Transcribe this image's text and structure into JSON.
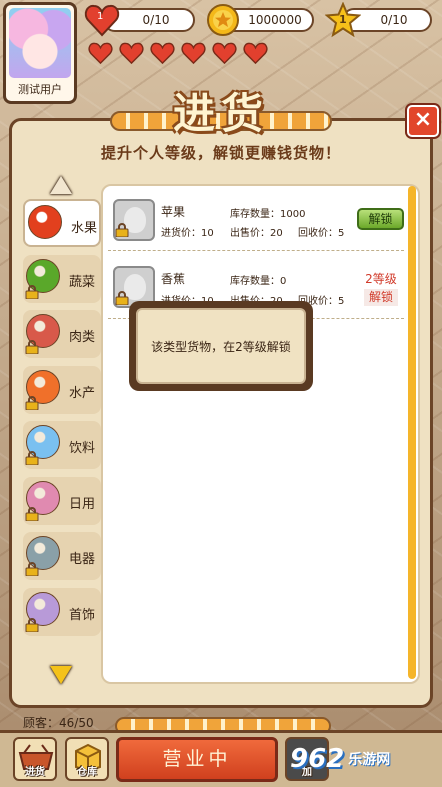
{
  "player": {
    "name": "测试用户"
  },
  "stats": {
    "hearts": "0/10",
    "heart_level": "1",
    "coins": "1000000",
    "star_level": "1",
    "stars": "0/10"
  },
  "lives_count": 6,
  "dialog": {
    "title": "进货",
    "subtitle": "提升个人等级，解锁更赚钱货物！",
    "close_label": "×"
  },
  "categories": [
    {
      "label": "水果",
      "icon": "apple-icon",
      "color": "#e2401e",
      "locked": false,
      "active": true
    },
    {
      "label": "蔬菜",
      "icon": "cabbage-icon",
      "color": "#5aa82a",
      "locked": true,
      "active": false
    },
    {
      "label": "肉类",
      "icon": "meat-icon",
      "color": "#d8594a",
      "locked": true,
      "active": false
    },
    {
      "label": "水产",
      "icon": "shrimp-icon",
      "color": "#f0702a",
      "locked": true,
      "active": false
    },
    {
      "label": "饮料",
      "icon": "bottle-icon",
      "color": "#7ac0f0",
      "locked": true,
      "active": false
    },
    {
      "label": "日用",
      "icon": "lotion-icon",
      "color": "#e08ab0",
      "locked": true,
      "active": false
    },
    {
      "label": "电器",
      "icon": "appliance-icon",
      "color": "#8aa0a8",
      "locked": true,
      "active": false
    },
    {
      "label": "首饰",
      "icon": "ring-icon",
      "color": "#b89ad8",
      "locked": true,
      "active": false
    }
  ],
  "items": [
    {
      "name": "苹果",
      "stock": "库存数量：1000",
      "cost": "进货价：10",
      "sale": "出售价：20",
      "recycle": "回收价：5",
      "action": "解锁"
    },
    {
      "name": "香蕉",
      "stock": "库存数量：0",
      "cost": "进货价：10",
      "sale": "出售价：20",
      "recycle": "回收价：5",
      "lock_level": "2等级",
      "lock_action": "解锁"
    }
  ],
  "tooltip": "该类型货物，在2等级解锁",
  "bottom": {
    "customers": "顾客：46/50",
    "stock_btn": "进货",
    "warehouse_btn": "仓库",
    "open_status": "营业中",
    "extra_btn": "加"
  },
  "watermark": {
    "logo": "962",
    "text": "乐游网"
  }
}
